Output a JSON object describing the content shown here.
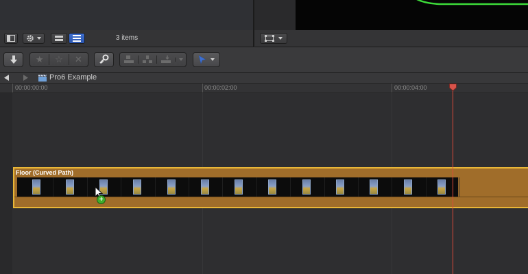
{
  "browser": {
    "items_count": "3 items"
  },
  "timeline": {
    "project_title": "Pro6 Example",
    "ruler": [
      {
        "label": "00:00:00:00"
      },
      {
        "label": "00:00:02:00"
      },
      {
        "label": "00:00:04:00"
      }
    ],
    "clip": {
      "label": "Floor (Curved Path)"
    }
  },
  "icons": {
    "add_badge": "+"
  },
  "colors": {
    "clip_fill": "#a06d2a",
    "clip_border": "#e9b737",
    "playhead": "#e04a3a",
    "viewer_shape": "#3ddc3a",
    "select_tool": "#3d6fd1"
  }
}
